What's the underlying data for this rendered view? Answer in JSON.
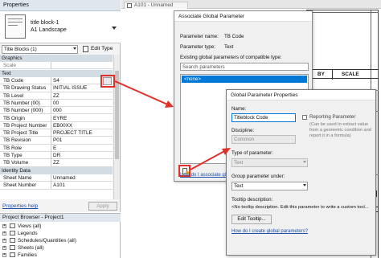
{
  "colors": {
    "accent": "#3399ff",
    "arrow": "#e0302a",
    "selected": "#0078d7",
    "link": "#1f4fa8"
  },
  "properties_panel": {
    "title": "Properties",
    "type_name": "title block-1",
    "type_sub": "A1 Landscape",
    "selector_value": "Title Blocks (1)",
    "edit_type": "Edit Type",
    "section_graphics": "Graphics",
    "scale_label": "Scale",
    "section_text": "Text",
    "rows": [
      {
        "key": "TB Code",
        "value": "S4"
      },
      {
        "key": "TB Drawing Status",
        "value": "INITIAL ISSUE"
      },
      {
        "key": "TB Level",
        "value": "ZZ"
      },
      {
        "key": "TB Number (00)",
        "value": "00"
      },
      {
        "key": "TB Number (000)",
        "value": "000"
      },
      {
        "key": "TB Origin",
        "value": "EYRE"
      },
      {
        "key": "TB Project Number",
        "value": "EB00XX"
      },
      {
        "key": "TB Project Title",
        "value": "PROJECT TITLE"
      },
      {
        "key": "TB Revision",
        "value": "P01"
      },
      {
        "key": "TB Role",
        "value": "E"
      },
      {
        "key": "TB Type",
        "value": "DR"
      },
      {
        "key": "TB Volume",
        "value": "ZZ"
      }
    ],
    "section_identity": "Identity Data",
    "identity_rows": [
      {
        "key": "Sheet Name",
        "value": "Unnamed"
      },
      {
        "key": "Sheet Number",
        "value": "A101"
      }
    ],
    "help_link": "Properties help",
    "apply": "Apply"
  },
  "project_browser": {
    "title": "Project Browser - Project1",
    "items": [
      "Views (all)",
      "Legends",
      "Schedules/Quantities (all)",
      "Sheets (all)",
      "Families"
    ]
  },
  "view_tab": {
    "label": "A101 - Unnamed"
  },
  "sheet_labels": {
    "by": "BY",
    "scale": "SCALE"
  },
  "assoc_dialog": {
    "title": "Associate Global Parameter",
    "param_name_label": "Parameter name:",
    "param_name_value": "TB Code",
    "param_type_label": "Parameter type:",
    "param_type_value": "Text",
    "existing_label": "Existing global parameters of compatible type:",
    "search_placeholder": "Search parameters",
    "list_items": [
      "<none>"
    ],
    "help_link": "How do I associate glob"
  },
  "gpp_dialog": {
    "title": "Global Parameter Properties",
    "name_label": "Name:",
    "name_value": "Titleblock Code",
    "reporting_label": "Reporting Parameter",
    "reporting_desc": "(Can be used to extract value from a geometric condition and report it in a formula)",
    "discipline_label": "Discipline:",
    "discipline_value": "Common",
    "type_label": "Type of parameter:",
    "type_value": "Text",
    "group_label": "Group parameter under:",
    "group_value": "Text",
    "tooltip_label": "Tooltip description:",
    "tooltip_value": "<No tooltip description. Edit this parameter to write a custom tool...",
    "edit_tooltip": "Edit Tooltip...",
    "help_link": "How do I create global parameters?"
  }
}
